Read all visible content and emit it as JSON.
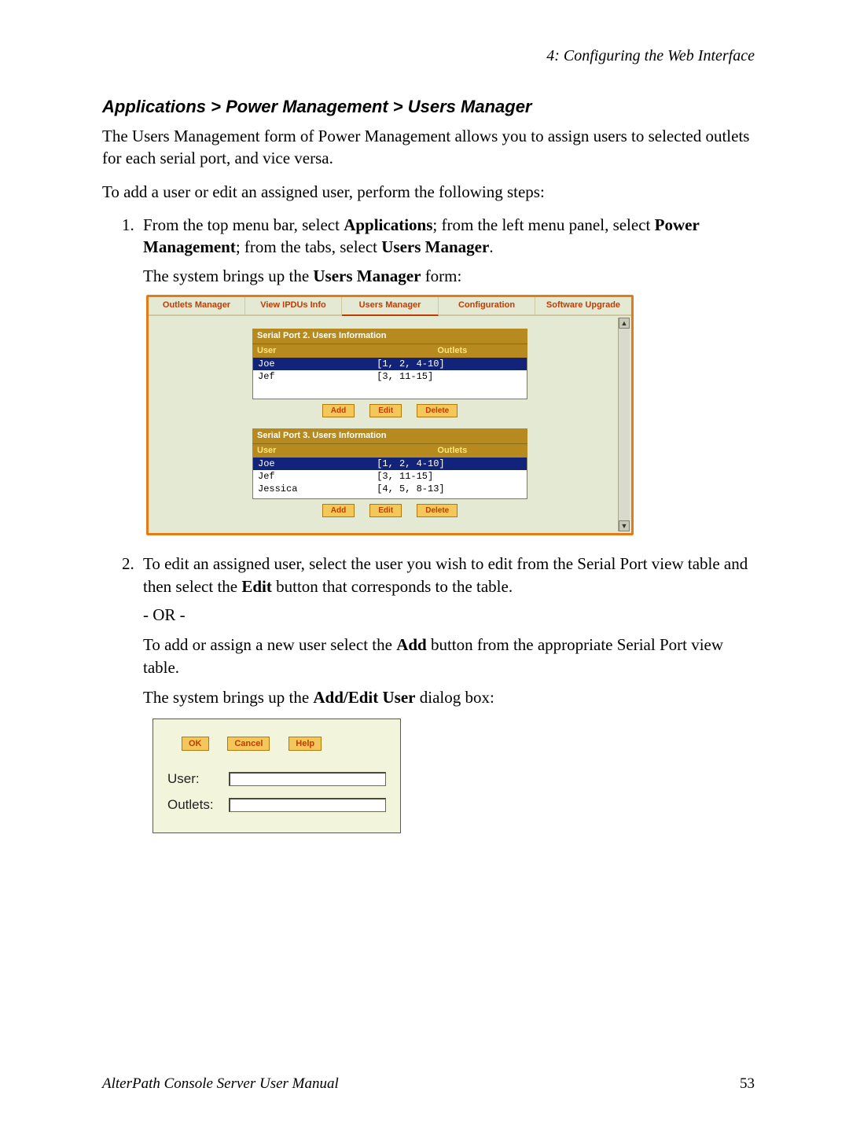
{
  "running_head": "4: Configuring the Web Interface",
  "section_title": "Applications > Power Management > Users Manager",
  "intro_p1": "The Users Management form of Power Management allows you to assign users to selected outlets for each serial port, and vice versa.",
  "intro_p2": "To add a user or edit an assigned user, perform the following steps:",
  "step1": {
    "pre": "From the top menu bar, select ",
    "b1": "Applications",
    "mid1": "; from the left menu panel, select ",
    "b2": "Power Management",
    "mid2": "; from the tabs, select ",
    "b3": "Users Manager",
    "post": ".",
    "result_pre": "The system brings up the ",
    "result_b": "Users Manager",
    "result_post": " form:"
  },
  "um": {
    "tabs": {
      "outlets": "Outlets Manager",
      "ipdus": "View IPDUs Info",
      "users": "Users Manager",
      "config": "Configuration",
      "upgrade": "Software Upgrade"
    },
    "panel2": {
      "title": "Serial Port 2. Users Information",
      "head_user": "User",
      "head_out": "Outlets",
      "rows": [
        {
          "user": "Joe",
          "out": "[1, 2, 4-10]",
          "selected": true
        },
        {
          "user": "Jef",
          "out": "[3, 11-15]",
          "selected": false
        }
      ]
    },
    "panel3": {
      "title": "Serial Port 3. Users Information",
      "head_user": "User",
      "head_out": "Outlets",
      "rows": [
        {
          "user": "Joe",
          "out": "[1, 2, 4-10]",
          "selected": true
        },
        {
          "user": "Jef",
          "out": "[3, 11-15]",
          "selected": false
        },
        {
          "user": "Jessica",
          "out": "[4, 5, 8-13]",
          "selected": false
        }
      ]
    },
    "btn_add": "Add",
    "btn_edit": "Edit",
    "btn_delete": "Delete"
  },
  "step2": {
    "p1_pre": "To edit an assigned user, select the user you wish to edit from the Serial Port view table and then select the ",
    "p1_b": "Edit",
    "p1_post": " button that corresponds to the table.",
    "or": " - OR - ",
    "p2_pre": "To add or assign a new user select the ",
    "p2_b": "Add",
    "p2_post": " button from the appropriate Serial Port view table.",
    "p3_pre": "The system brings up the ",
    "p3_b": "Add/Edit User",
    "p3_post": " dialog box:"
  },
  "ae": {
    "btn_ok": "OK",
    "btn_cancel": "Cancel",
    "btn_help": "Help",
    "label_user": "User:",
    "label_outlets": "Outlets:",
    "value_user": "",
    "value_outlets": ""
  },
  "footer": {
    "manual": "AlterPath Console Server User Manual",
    "page": "53"
  }
}
